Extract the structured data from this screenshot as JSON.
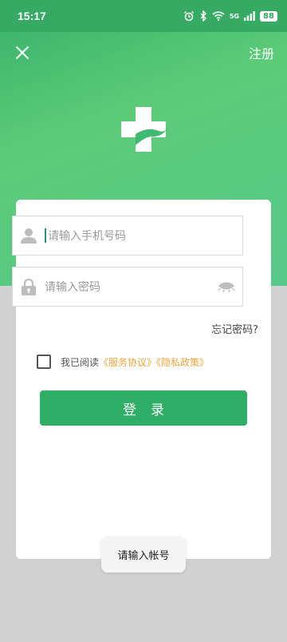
{
  "status_bar": {
    "time": "15:17",
    "network": "5G",
    "battery": "88"
  },
  "nav": {
    "close_icon": "close-icon",
    "register_label": "注册"
  },
  "logo": {
    "icon": "medical-cross-hand-icon",
    "color": "#ffffff"
  },
  "form": {
    "phone": {
      "placeholder": "请输入手机号码",
      "value": ""
    },
    "password": {
      "placeholder": "请输入密码",
      "value": ""
    },
    "forgot_label": "忘记密码?",
    "agree_prefix": "我已阅读",
    "service_link": "《服务协议》",
    "privacy_link": "《隐私政策》",
    "agreed": false,
    "login_label": "登录"
  },
  "toast": {
    "text": "请输入帐号"
  },
  "colors": {
    "brand_green": "#2fae67",
    "link_orange": "#f0a43a",
    "status_green": "#36a962"
  }
}
